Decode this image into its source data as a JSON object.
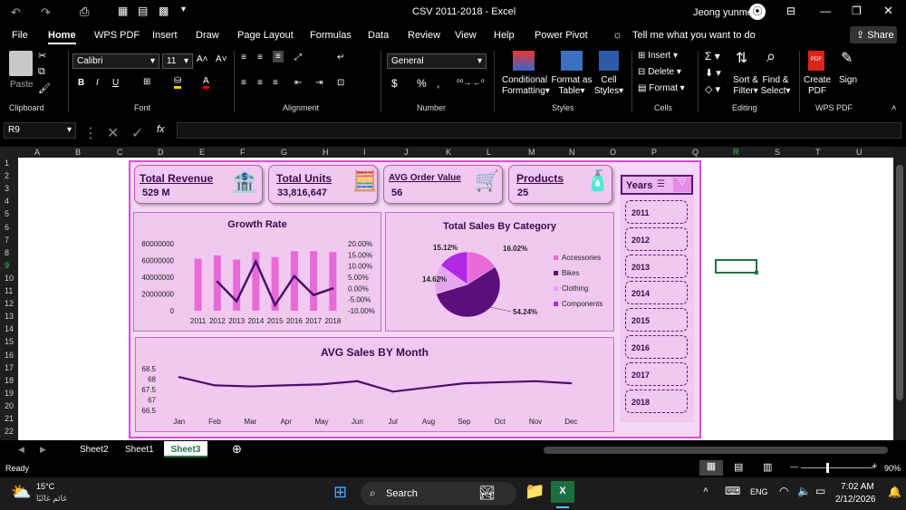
{
  "titlebar": {
    "doc_title": "CSV 2011-2018  -  Excel",
    "user": "Jeong yunme"
  },
  "menu": [
    "File",
    "Home",
    "WPS PDF",
    "Insert",
    "Draw",
    "Page Layout",
    "Formulas",
    "Data",
    "Review",
    "View",
    "Help",
    "Power Pivot"
  ],
  "active_menu": "Home",
  "tell_me": "Tell me what you want to do",
  "share": "Share",
  "ribbon": {
    "paste": "Paste",
    "font_name": "Calibri",
    "font_size": "11",
    "number_format": "General",
    "conditional": [
      "Conditional",
      "Formatting"
    ],
    "format_table": [
      "Format as",
      "Table"
    ],
    "cell_styles": [
      "Cell",
      "Styles"
    ],
    "insert": "Insert",
    "delete": "Delete",
    "format": "Format",
    "sort": [
      "Sort &",
      "Filter"
    ],
    "find": [
      "Find &",
      "Select"
    ],
    "create_pdf": [
      "Create",
      "PDF"
    ],
    "sign": "Sign",
    "groups": [
      "Clipboard",
      "Font",
      "Alignment",
      "Number",
      "Styles",
      "Cells",
      "Editing",
      "WPS PDF"
    ]
  },
  "formula_bar": {
    "name_box": "R9",
    "fx": "fx",
    "value": ""
  },
  "columns": [
    "A",
    "B",
    "C",
    "D",
    "E",
    "F",
    "G",
    "H",
    "I",
    "J",
    "K",
    "L",
    "M",
    "N",
    "O",
    "P",
    "Q",
    "R",
    "S",
    "T",
    "U"
  ],
  "rows": [
    "1",
    "2",
    "3",
    "4",
    "5",
    "6",
    "7",
    "8",
    "9",
    "10",
    "11",
    "12",
    "13",
    "14",
    "15",
    "16",
    "17",
    "18",
    "19",
    "20",
    "21",
    "22"
  ],
  "kpis": [
    {
      "label": "Total Revenue",
      "value": "529 M"
    },
    {
      "label": "Total Units",
      "value": "33,816,647"
    },
    {
      "label": "AVG Order Value",
      "value": "56"
    },
    {
      "label": "Products",
      "value": "25"
    }
  ],
  "slicer": {
    "title": "Years",
    "items": [
      "2011",
      "2012",
      "2013",
      "2014",
      "2015",
      "2016",
      "2017",
      "2018"
    ]
  },
  "chart_data": [
    {
      "type": "bar",
      "title": "Growth Rate",
      "categories": [
        "2011",
        "2012",
        "2013",
        "2014",
        "2015",
        "2016",
        "2017",
        "2018"
      ],
      "series": [
        {
          "values": [
            62000000,
            66000000,
            61000000,
            70000000,
            64000000,
            71000000,
            71000000,
            70000000
          ]
        },
        {
          "values": [
            null,
            3.0,
            -5.8,
            12.0,
            -7.5,
            5.5,
            -3.0,
            0.0
          ]
        }
      ],
      "left_ticks": [
        "80000000",
        "60000000",
        "40000000",
        "20000000",
        "0"
      ],
      "right_ticks": [
        "20.00%",
        "15.00%",
        "10.00%",
        "5.00%",
        "0.00%",
        "-5.00%",
        "-10.00%"
      ],
      "ylim": [
        0,
        80000000
      ],
      "y2lim": [
        -10,
        20
      ]
    },
    {
      "type": "pie",
      "title": "Total Sales By Category",
      "labels": [
        "Accessories",
        "Bikes",
        "Clothing",
        "Components"
      ],
      "values": [
        16.02,
        54.24,
        14.62,
        15.12
      ],
      "value_labels": [
        "16.02%",
        "54.24%",
        "14.62%",
        "15.12%"
      ],
      "colors": [
        "#e86ad6",
        "#5a0f7a",
        "#e6a6ee",
        "#b128e6"
      ]
    },
    {
      "type": "line",
      "title": "AVG Sales BY Month",
      "categories": [
        "Jan",
        "Feb",
        "Mar",
        "Apr",
        "May",
        "Jun",
        "Jul",
        "Aug",
        "Sep",
        "Oct",
        "Nov",
        "Dec"
      ],
      "series": [
        {
          "values": [
            68.1,
            67.7,
            67.65,
            67.7,
            67.75,
            67.9,
            67.4,
            67.6,
            67.8,
            67.85,
            67.9,
            67.8
          ]
        }
      ],
      "y_ticks": [
        "68.5",
        "68",
        "67.5",
        "67",
        "66.5"
      ],
      "ylim": [
        66.5,
        68.5
      ]
    }
  ],
  "sheet_tabs": [
    "Sheet2",
    "Sheet1",
    "Sheet3"
  ],
  "active_sheet": "Sheet3",
  "status": {
    "mode": "Ready",
    "zoom": "90%"
  },
  "taskbar": {
    "temp": "15°C",
    "weather": "غائم غالبًا",
    "search": "Search",
    "lang": "ENG",
    "time": "7:02 AM",
    "date": "2/12/2026"
  },
  "colors": {
    "accent": "#217346",
    "dash_bg": "#f0c8f0",
    "dash_border": "#e04ae0",
    "text_dark": "#3b0b4a"
  }
}
